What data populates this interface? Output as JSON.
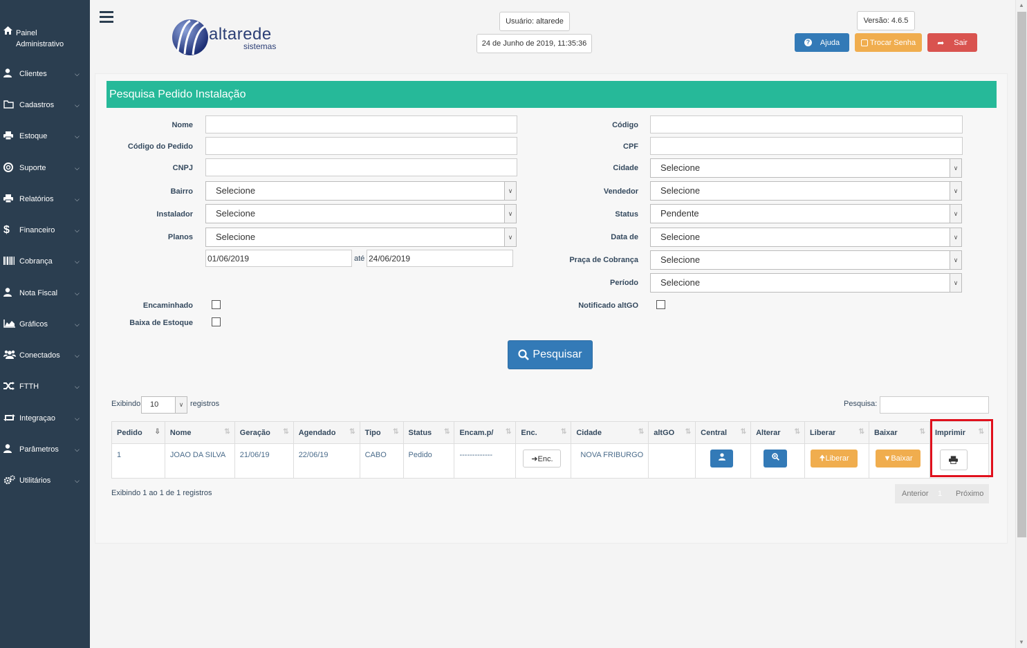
{
  "sidebar": {
    "top": {
      "icon": "home-icon",
      "line1": "Painel",
      "line2": "Administrativo"
    },
    "items": [
      {
        "label": "Clientes",
        "icon": "user-icon"
      },
      {
        "label": "Cadastros",
        "icon": "folder-icon"
      },
      {
        "label": "Estoque",
        "icon": "printer-icon"
      },
      {
        "label": "Suporte",
        "icon": "lifebuoy-icon"
      },
      {
        "label": "Relatórios",
        "icon": "printer-icon"
      },
      {
        "label": "Financeiro",
        "icon": "dollar-icon"
      },
      {
        "label": "Cobrança",
        "icon": "barcode-icon"
      },
      {
        "label": "Nota Fiscal",
        "icon": "user-icon"
      },
      {
        "label": "Gráficos",
        "icon": "area-chart-icon"
      },
      {
        "label": "Conectados",
        "icon": "users-icon"
      },
      {
        "label": "FTTH",
        "icon": "random-icon"
      },
      {
        "label": "Integraçao",
        "icon": "retweet-icon"
      },
      {
        "label": "Parâmetros",
        "icon": "user-icon"
      },
      {
        "label": "Utilitários",
        "icon": "cogs-icon"
      }
    ]
  },
  "header": {
    "logo_text": "altarede",
    "logo_sub": "sistemas",
    "user": "Usuário: altarede",
    "datetime": "24 de Junho de 2019, 11:35:36",
    "version": "Versão: 4.6.5",
    "help_label": "Ajuda",
    "change_password_label": "Trocar Senha",
    "logout_label": "Sair"
  },
  "form": {
    "title": "Pesquisa Pedido Instalação",
    "labels": {
      "nome": "Nome",
      "codigo_pedido": "Código do Pedido",
      "cnpj": "CNPJ",
      "bairro": "Bairro",
      "instalador": "Instalador",
      "planos": "Planos",
      "encaminhado": "Encaminhado",
      "baixa_estoque": "Baixa de Estoque",
      "codigo": "Código",
      "cpf": "CPF",
      "cidade": "Cidade",
      "vendedor": "Vendedor",
      "status": "Status",
      "data_de": "Data de",
      "praca_cobranca": "Praça de Cobrança",
      "periodo": "Período",
      "notificado": "Notificado altGO",
      "ate": "até"
    },
    "values": {
      "bairro": "Selecione",
      "instalador": "Selecione",
      "planos": "Selecione",
      "date_from": "01/06/2019",
      "date_to": "24/06/2019",
      "cidade": "Selecione",
      "vendedor": "Selecione",
      "status": "Pendente",
      "data_de": "Selecione",
      "praca_cobranca": "Selecione",
      "periodo": "Selecione"
    },
    "search_label": "Pesquisar"
  },
  "table_controls": {
    "show_prefix": "Exibindo",
    "page_size": "10",
    "show_suffix": "registros",
    "search_label": "Pesquisa:",
    "info": "Exibindo 1 ao 1 de 1 registros",
    "prev": "Anterior",
    "page": "1",
    "next": "Próximo"
  },
  "table": {
    "columns": [
      "Pedido",
      "Nome",
      "Geração",
      "Agendado",
      "Tipo",
      "Status",
      "Encam.p/",
      "Enc.",
      "Cidade",
      "altGO",
      "Central",
      "Alterar",
      "Liberar",
      "Baixar",
      "Imprimir"
    ],
    "rows": [
      {
        "pedido": "1",
        "nome": "JOAO DA SILVA",
        "geracao": "21/06/19",
        "agendado": "22/06/19",
        "tipo": "CABO",
        "status": "Pedido",
        "encam": "-------------",
        "enc_label": "Enc.",
        "cidade": "NOVA FRIBURGO",
        "altgo": "",
        "liberar_label": "Liberar",
        "baixar_label": "Baixar"
      }
    ]
  },
  "colors": {
    "sidebar": "#2b3e50",
    "title_bar": "#26b999",
    "primary": "#337ab7",
    "warning": "#f0ad4e",
    "danger": "#d9534f",
    "highlight": "#e0101c"
  }
}
